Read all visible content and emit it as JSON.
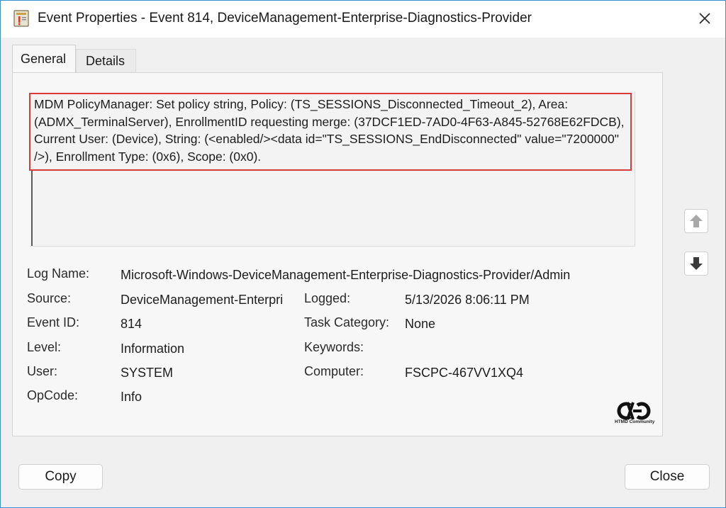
{
  "window": {
    "title": "Event Properties - Event 814, DeviceManagement-Enterprise-Diagnostics-Provider"
  },
  "tabs": [
    {
      "label": "General",
      "active": true
    },
    {
      "label": "Details",
      "active": false
    }
  ],
  "event": {
    "description": "MDM PolicyManager: Set policy string, Policy: (TS_SESSIONS_Disconnected_Timeout_2), Area: (ADMX_TerminalServer), EnrollmentID requesting merge: (37DCF1ED-7AD0-4F63-A845-52768E62FDCB), Current User: (Device), String: (<enabled/><data id=\"TS_SESSIONS_EndDisconnected\" value=\"7200000\" />), Enrollment Type: (0x6), Scope: (0x0).",
    "fields": {
      "log_name": {
        "label": "Log Name:",
        "value": "Microsoft-Windows-DeviceManagement-Enterprise-Diagnostics-Provider/Admin"
      },
      "source": {
        "label": "Source:",
        "value": "DeviceManagement-Enterpri"
      },
      "logged": {
        "label": "Logged:",
        "value": "5/13/2026 8:06:11 PM"
      },
      "event_id": {
        "label": "Event ID:",
        "value": "814"
      },
      "task_category": {
        "label": "Task Category:",
        "value": "None"
      },
      "level": {
        "label": "Level:",
        "value": "Information"
      },
      "keywords": {
        "label": "Keywords:",
        "value": ""
      },
      "user": {
        "label": "User:",
        "value": "SYSTEM"
      },
      "computer": {
        "label": "Computer:",
        "value": "FSCPC-467VV1XQ4"
      },
      "opcode": {
        "label": "OpCode:",
        "value": "Info"
      }
    }
  },
  "watermark": {
    "text": "HTMD Community"
  },
  "buttons": {
    "copy": "Copy",
    "close": "Close"
  },
  "colors": {
    "highlight_border": "#d93a3a",
    "window_border": "#3b8fd6"
  }
}
